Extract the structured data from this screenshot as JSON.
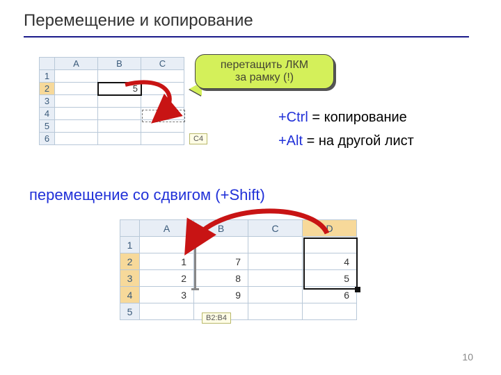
{
  "title": "Перемещение и копирование",
  "page_number": "10",
  "callout": {
    "line1": "перетащить ЛКМ",
    "line2": "за рамку (!)"
  },
  "notes": {
    "ctrl_key": "+Ctrl",
    "ctrl_text": " = копирование",
    "alt_key": "+Alt",
    "alt_text": " = на другой лист"
  },
  "subtitle": "перемещение со сдвигом (+Shift)",
  "sheet1": {
    "cols": [
      "A",
      "B",
      "C"
    ],
    "rows": [
      "1",
      "2",
      "3",
      "4",
      "5",
      "6"
    ],
    "b2": "5",
    "tip": "C4"
  },
  "sheet2": {
    "cols": [
      "A",
      "B",
      "C",
      "D"
    ],
    "rows": [
      "1",
      "2",
      "3",
      "4",
      "5"
    ],
    "cells": {
      "A2": "1",
      "A3": "2",
      "A4": "3",
      "B2": "7",
      "B3": "8",
      "B4": "9",
      "D2": "4",
      "D3": "5",
      "D4": "6"
    },
    "tip": "B2:B4"
  }
}
